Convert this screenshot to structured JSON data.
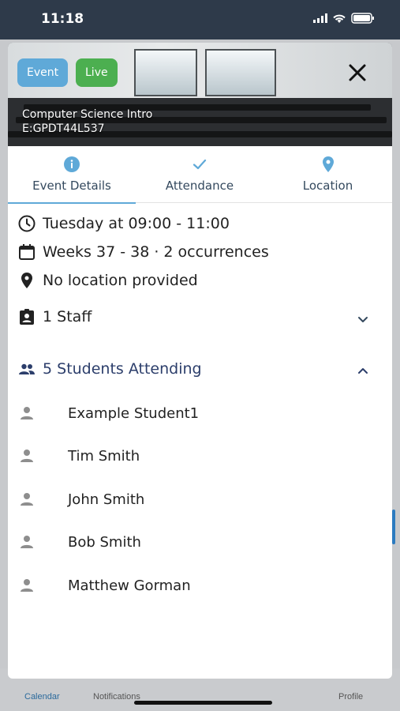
{
  "status_bar": {
    "time": "11:18"
  },
  "background_app": {
    "tabs": [
      {
        "label": "Calendar",
        "active": true
      },
      {
        "label": "Notifications",
        "active": false
      },
      {
        "label": "Profile",
        "active": false
      }
    ]
  },
  "event": {
    "badges": {
      "type": "Event",
      "status": "Live"
    },
    "title": "Computer Science Intro",
    "code": "E:GPDT44L537"
  },
  "tabs": [
    {
      "label": "Event Details",
      "icon": "info-icon",
      "active": true
    },
    {
      "label": "Attendance",
      "icon": "check-icon",
      "active": false
    },
    {
      "label": "Location",
      "icon": "location-pin-icon",
      "active": false
    }
  ],
  "details": {
    "time": "Tuesday at 09:00 - 11:00",
    "weeks": "Weeks 37 - 38 · 2 occurrences",
    "location": "No location provided",
    "staff": "1 Staff",
    "students_header": "5 Students Attending"
  },
  "students": [
    "Example Student1",
    "Tim Smith",
    "John Smith",
    "Bob Smith",
    "Matthew Gorman"
  ],
  "colors": {
    "accent": "#5fa9d8",
    "live": "#4caf50",
    "heading": "#2c3e6b"
  }
}
